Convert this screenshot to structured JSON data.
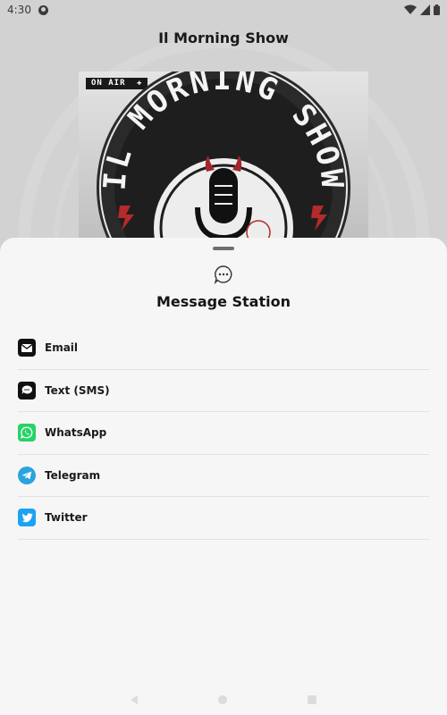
{
  "status_bar": {
    "time": "4:30"
  },
  "app": {
    "title": "Il Morning Show",
    "artwork": {
      "on_air_label": "ON AIR",
      "logo_text_top": "IL MORNING SHOW"
    }
  },
  "sheet": {
    "title": "Message Station",
    "options": [
      {
        "label": "Email",
        "icon": "email-icon",
        "color": "#111111"
      },
      {
        "label": "Text (SMS)",
        "icon": "sms-icon",
        "color": "#111111"
      },
      {
        "label": "WhatsApp",
        "icon": "whatsapp-icon",
        "color": "#25D366"
      },
      {
        "label": "Telegram",
        "icon": "telegram-icon",
        "color": "#2AA3DE"
      },
      {
        "label": "Twitter",
        "icon": "twitter-icon",
        "color": "#1DA1F2"
      }
    ]
  },
  "colors": {
    "sheet_background": "#f6f6f6",
    "whatsapp": "#25D366",
    "telegram": "#2AA3DE",
    "twitter": "#1DA1F2"
  }
}
